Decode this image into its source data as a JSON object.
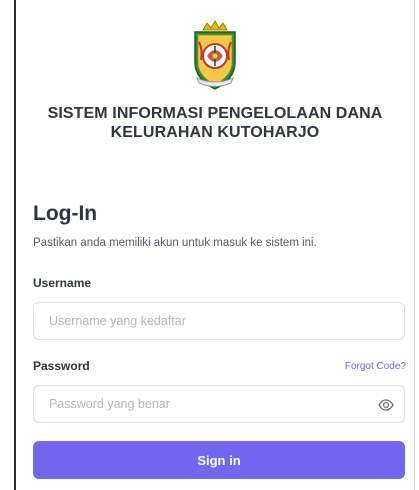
{
  "app": {
    "title_line1": "SISTEM INFORMASI PENGELOLAAN DANA",
    "title_line2": "KELURAHAN KUTOHARJO",
    "logo_icon": "kendal-regency-emblem-icon"
  },
  "login": {
    "heading": "Log-In",
    "subtext": "Pastikan anda memiliki akun untuk masuk ke sistem ini."
  },
  "username": {
    "label": "Username",
    "placeholder": "Username yang kedaftar",
    "value": ""
  },
  "password": {
    "label": "Password",
    "placeholder": "Password yang benar",
    "value": "",
    "forgot_label": "Forgot Code?",
    "toggle_icon": "eye-icon"
  },
  "signin": {
    "label": "Sign in"
  },
  "colors": {
    "accent": "#7367f0",
    "text_dark": "#2f3542",
    "border": "#dcdfe6",
    "placeholder": "#b4b7bd"
  }
}
